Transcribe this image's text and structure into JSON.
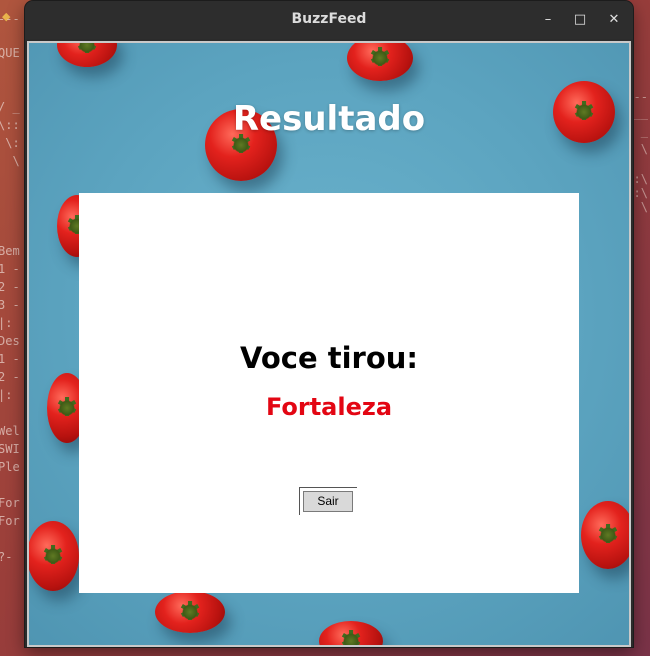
{
  "window": {
    "title": "BuzzFeed",
    "controls": {
      "minimize": "–",
      "maximize": "□",
      "close": "✕"
    }
  },
  "terminal_fragments": {
    "left": [
      "---",
      "QUE",
      "",
      "",
      "/ _",
      "\\::",
      " \\:",
      "  \\",
      "",
      "",
      "Bem",
      "1 -",
      "2 -",
      "3 -",
      "|:",
      "Des",
      "1 -",
      "2 -",
      "|:",
      "",
      "Wel",
      "SWI",
      "Ple",
      "",
      "For",
      "For",
      "",
      "?-"
    ],
    "right": [
      "--",
      "__",
      "_",
      "\\",
      ":\\",
      ":\\",
      "\\"
    ]
  },
  "screen": {
    "heading": "Resultado",
    "you_got_label": "Voce tirou:",
    "result": "Fortaleza",
    "exit_button": "Sair"
  },
  "colors": {
    "result_text": "#e30613",
    "background": "#5fa6c2",
    "panel": "#ffffff"
  }
}
